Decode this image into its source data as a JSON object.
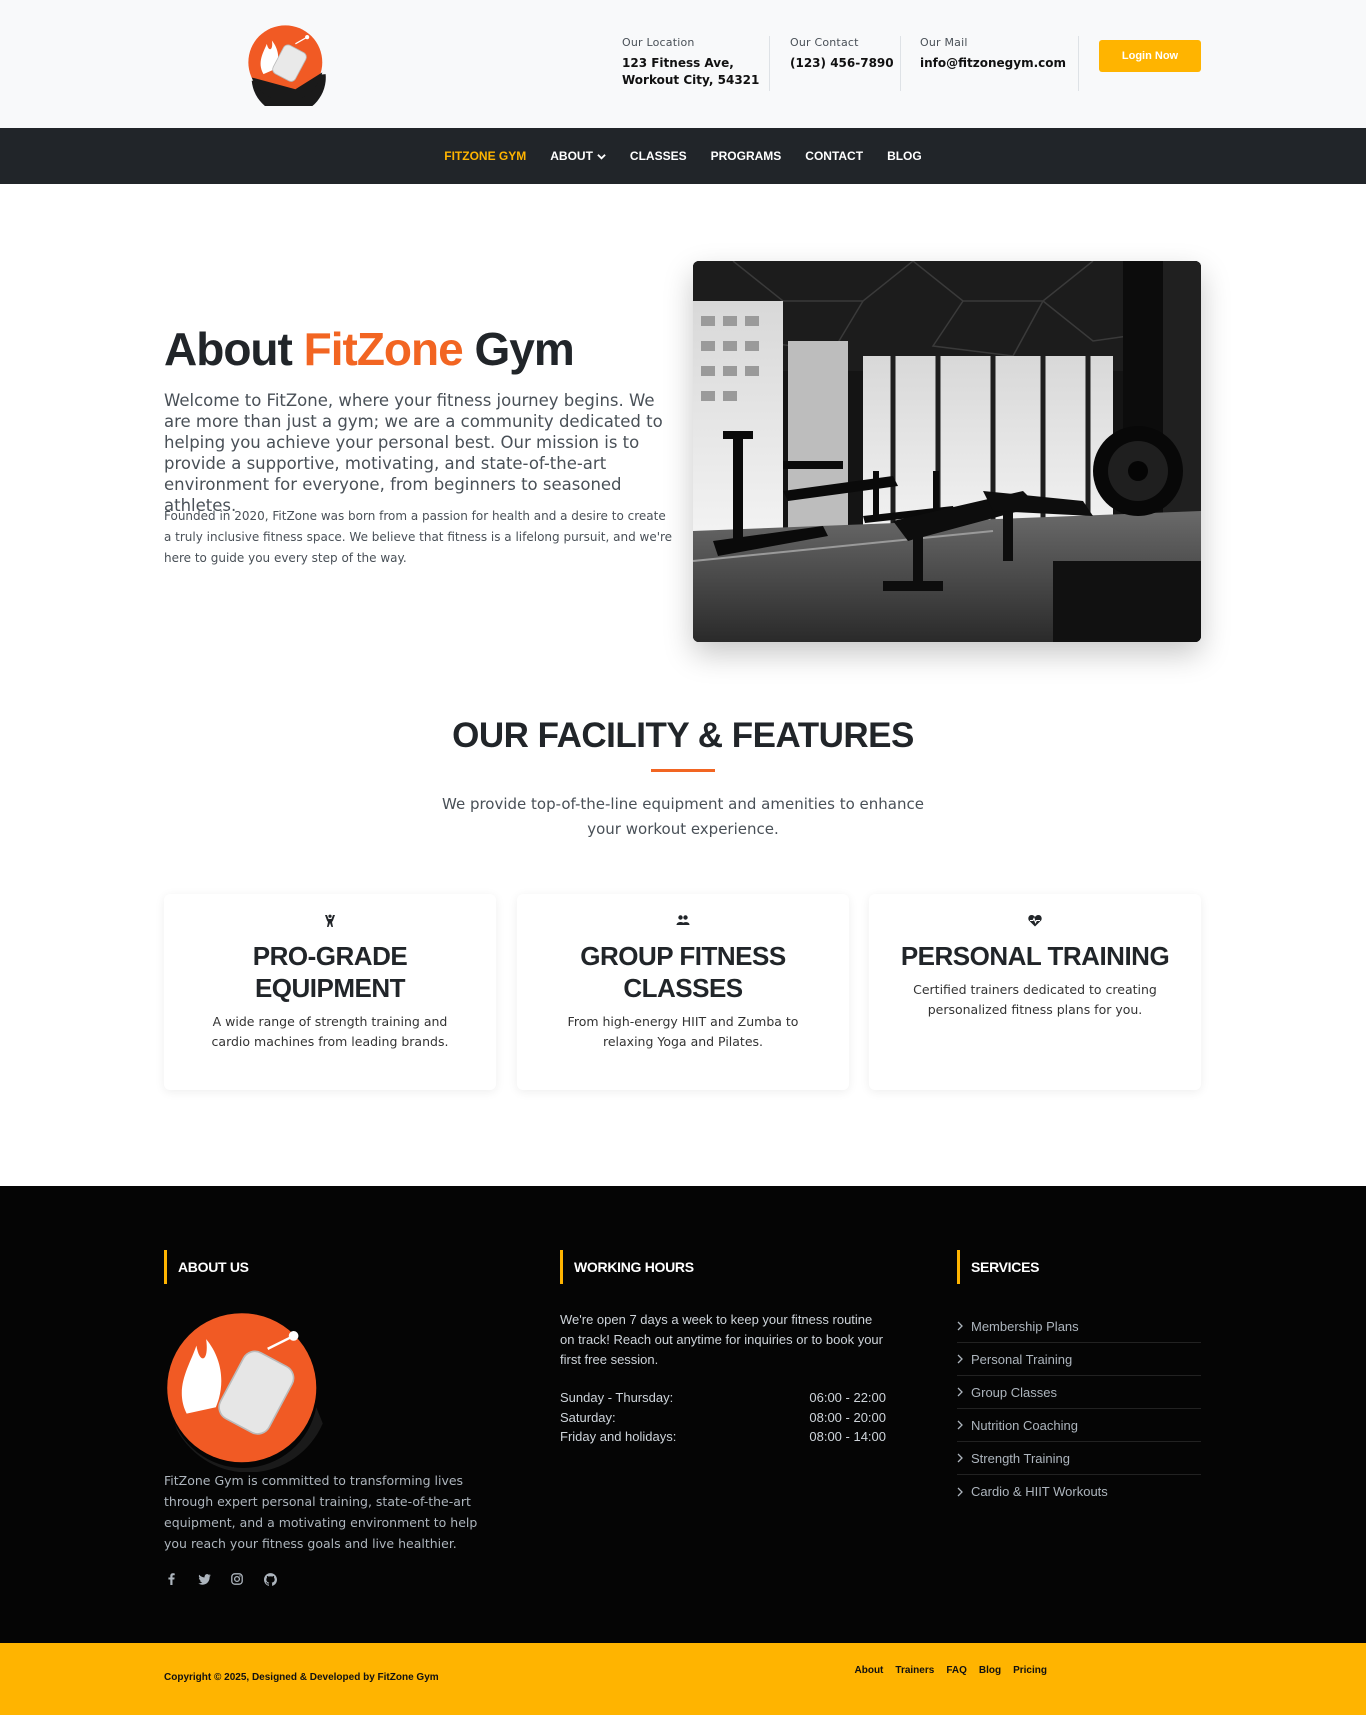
{
  "header": {
    "location_label": "Our Location",
    "location_line1": "123 Fitness Ave,",
    "location_line2": "Workout City, 54321",
    "contact_label": "Our Contact",
    "contact_value": "(123) 456-7890",
    "mail_label": "Our Mail",
    "mail_value": "info@fitzonegym.com",
    "login_label": "Login Now"
  },
  "nav": {
    "items": [
      {
        "label": "FITZONE GYM"
      },
      {
        "label": "ABOUT"
      },
      {
        "label": "CLASSES"
      },
      {
        "label": "PROGRAMS"
      },
      {
        "label": "CONTACT"
      },
      {
        "label": "BLOG"
      }
    ]
  },
  "about": {
    "title_pre": "About ",
    "title_highlight": "FitZone",
    "title_post": " Gym",
    "lead": "Welcome to FitZone, where your fitness journey begins. We are more than just a gym; we are a community dedicated to helping you achieve your personal best. Our mission is to provide a supportive, motivating, and state-of-the-art environment for everyone, from beginners to seasoned athletes.",
    "small": "Founded in 2020, FitZone was born from a passion for health and a desire to create a truly inclusive fitness space. We believe that fitness is a lifelong pursuit, and we're here to guide you every step of the way."
  },
  "facility": {
    "title": "OUR FACILITY & FEATURES",
    "subtitle": "We provide top-of-the-line equipment and amenities to enhance your workout experience.",
    "cards": [
      {
        "icon": "weightlifter-icon",
        "title": "PRO-GRADE EQUIPMENT",
        "text": "A wide range of strength training and cardio machines from leading brands."
      },
      {
        "icon": "users-icon",
        "title": "GROUP FITNESS CLASSES",
        "text": "From high-energy HIIT and Zumba to relaxing Yoga and Pilates."
      },
      {
        "icon": "heart-pulse-icon",
        "title": "PERSONAL TRAINING",
        "text": "Certified trainers dedicated to creating personalized fitness plans for you."
      }
    ]
  },
  "footer": {
    "about_heading": "ABOUT US",
    "about_text": "FitZone Gym is committed to transforming lives through expert personal training, state-of-the-art equipment, and a motivating environment to help you reach your fitness goals and live healthier.",
    "hours_heading": "WORKING HOURS",
    "hours_intro": "We're open 7 days a week to keep your fitness routine on track! Reach out anytime for inquiries or to book your first free session.",
    "hours": [
      {
        "day": "Sunday - Thursday:",
        "time": "06:00 - 22:00"
      },
      {
        "day": "Saturday:",
        "time": "08:00 - 20:00"
      },
      {
        "day": "Friday and holidays:",
        "time": "08:00 - 14:00"
      }
    ],
    "services_heading": "SERVICES",
    "services": [
      {
        "label": "Membership Plans"
      },
      {
        "label": "Personal Training"
      },
      {
        "label": "Group Classes"
      },
      {
        "label": "Nutrition Coaching"
      },
      {
        "label": "Strength Training"
      },
      {
        "label": "Cardio & HIIT Workouts"
      }
    ],
    "socials": [
      "facebook-icon",
      "twitter-icon",
      "instagram-icon",
      "github-icon"
    ]
  },
  "bottom": {
    "copyright": "Copyright © 2025, Designed & Developed by FitZone Gym",
    "links": [
      {
        "label": "About"
      },
      {
        "label": "Trainers"
      },
      {
        "label": "FAQ"
      },
      {
        "label": "Blog"
      },
      {
        "label": "Pricing"
      }
    ]
  },
  "colors": {
    "accent_orange": "#f26522",
    "accent_yellow": "#ffb400",
    "nav_bg": "#212529",
    "footer_bg": "#050505"
  }
}
